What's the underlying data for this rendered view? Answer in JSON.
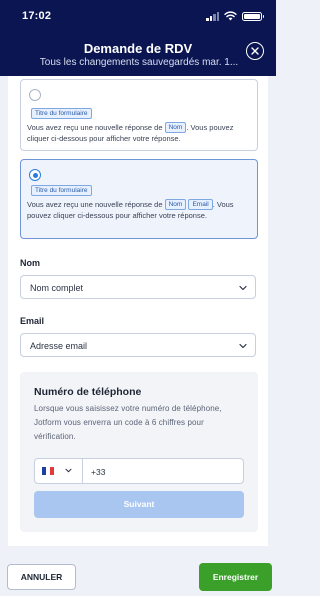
{
  "status_bar": {
    "time": "17:02"
  },
  "header": {
    "title": "Demande de RDV",
    "subtitle": "Tous les changements sauvegardés mar. 1..."
  },
  "options": [
    {
      "selected": false,
      "chip_title": "Titre du formulaire",
      "text_before": "Vous avez reçu une nouvelle réponse de",
      "fields": [
        "Nom"
      ],
      "text_after": ". Vous pouvez cliquer ci-dessous pour afficher votre réponse."
    },
    {
      "selected": true,
      "chip_title": "Titre du formulaire",
      "text_before": "Vous avez reçu une nouvelle réponse de",
      "fields": [
        "Nom",
        "Email"
      ],
      "text_after": ". Vous pouvez cliquer ci-dessous pour afficher votre réponse."
    }
  ],
  "nom": {
    "label": "Nom",
    "value": "Nom complet"
  },
  "email": {
    "label": "Email",
    "value": "Adresse email"
  },
  "phone": {
    "title": "Numéro de téléphone",
    "description": "Lorsque vous saisissez votre numéro de téléphone, Jotform vous enverra un code à 6 chiffres pour vérification.",
    "country_code": "+33",
    "next_label": "Suivant"
  },
  "footer": {
    "cancel_label": "ANNULER",
    "save_label": "Enregistrer"
  },
  "colors": {
    "header_bg": "#0a1551",
    "accent_blue": "#2a7ae4",
    "next_disabled": "#a9c6f1",
    "save_green": "#3aa02a"
  },
  "icons": [
    "close-icon",
    "chevron-down-icon",
    "flag-france-icon",
    "signal-icon",
    "wifi-icon",
    "battery-icon"
  ]
}
